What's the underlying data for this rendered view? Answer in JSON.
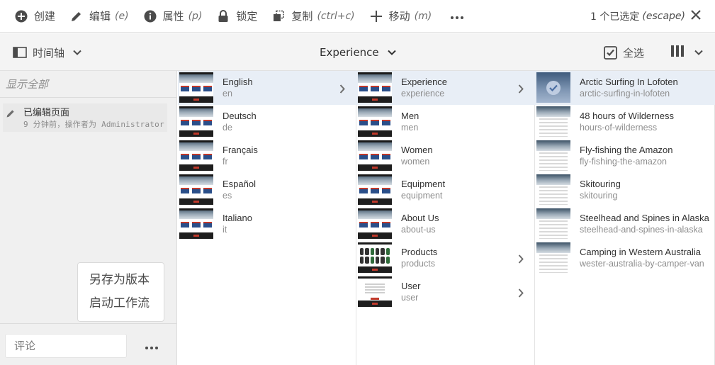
{
  "actionbar": {
    "items": [
      {
        "label": "创建",
        "shortcut": "",
        "icon": "plus-circle-icon"
      },
      {
        "label": "编辑",
        "shortcut": "(e)",
        "icon": "pencil-icon"
      },
      {
        "label": "属性",
        "shortcut": "(p)",
        "icon": "info-icon"
      },
      {
        "label": "锁定",
        "shortcut": "",
        "icon": "lock-icon"
      },
      {
        "label": "复制",
        "shortcut": "(ctrl+c)",
        "icon": "copy-icon"
      },
      {
        "label": "移动",
        "shortcut": "(m)",
        "icon": "move-icon"
      }
    ],
    "more_icon": "more-icon",
    "selection": "1 个已选定",
    "selection_shortcut": "(escape)",
    "close_icon": "close-icon"
  },
  "toolbar": {
    "rail_label": "时间轴",
    "title": "Experience",
    "select_all": "全选",
    "view_icon": "column-view-icon"
  },
  "rail": {
    "filter": "显示全部",
    "timeline": {
      "title": "已编辑页面",
      "subtitle": "9 分钟前，操作者为 Administrator"
    },
    "popover": [
      "另存为版本",
      "启动工作流"
    ],
    "comment_placeholder": "评论"
  },
  "columns": [
    {
      "rows": [
        {
          "title": "English",
          "name": "en",
          "thumb": "site",
          "has_children": true,
          "selected": true
        },
        {
          "title": "Deutsch",
          "name": "de",
          "thumb": "site",
          "has_children": false,
          "selected": false
        },
        {
          "title": "Français",
          "name": "fr",
          "thumb": "site",
          "has_children": false,
          "selected": false
        },
        {
          "title": "Español",
          "name": "es",
          "thumb": "site",
          "has_children": false,
          "selected": false
        },
        {
          "title": "Italiano",
          "name": "it",
          "thumb": "site",
          "has_children": false,
          "selected": false
        }
      ]
    },
    {
      "rows": [
        {
          "title": "Experience",
          "name": "experience",
          "thumb": "site",
          "has_children": true,
          "selected": true
        },
        {
          "title": "Men",
          "name": "men",
          "thumb": "site",
          "has_children": false,
          "selected": false
        },
        {
          "title": "Women",
          "name": "women",
          "thumb": "site",
          "has_children": false,
          "selected": false
        },
        {
          "title": "Equipment",
          "name": "equipment",
          "thumb": "site",
          "has_children": false,
          "selected": false
        },
        {
          "title": "About Us",
          "name": "about-us",
          "thumb": "site",
          "has_children": false,
          "selected": false
        },
        {
          "title": "Products",
          "name": "products",
          "thumb": "products",
          "has_children": true,
          "selected": false
        },
        {
          "title": "User",
          "name": "user",
          "thumb": "user",
          "has_children": true,
          "selected": false
        }
      ]
    },
    {
      "rows": [
        {
          "title": "Arctic Surfing In Lofoten",
          "name": "arctic-surfing-in-lofoten",
          "thumb": "checked",
          "has_children": false,
          "selected": true
        },
        {
          "title": "48 hours of Wilderness",
          "name": "hours-of-wilderness",
          "thumb": "article",
          "has_children": false,
          "selected": false
        },
        {
          "title": "Fly-fishing the Amazon",
          "name": "fly-fishing-the-amazon",
          "thumb": "article",
          "has_children": false,
          "selected": false
        },
        {
          "title": "Skitouring",
          "name": "skitouring",
          "thumb": "article",
          "has_children": false,
          "selected": false
        },
        {
          "title": "Steelhead and Spines in Alaska",
          "name": "steelhead-and-spines-in-alaska",
          "thumb": "article",
          "has_children": false,
          "selected": false
        },
        {
          "title": "Camping in Western Australia",
          "name": "wester-australia-by-camper-van",
          "thumb": "article",
          "has_children": false,
          "selected": false
        }
      ]
    }
  ]
}
